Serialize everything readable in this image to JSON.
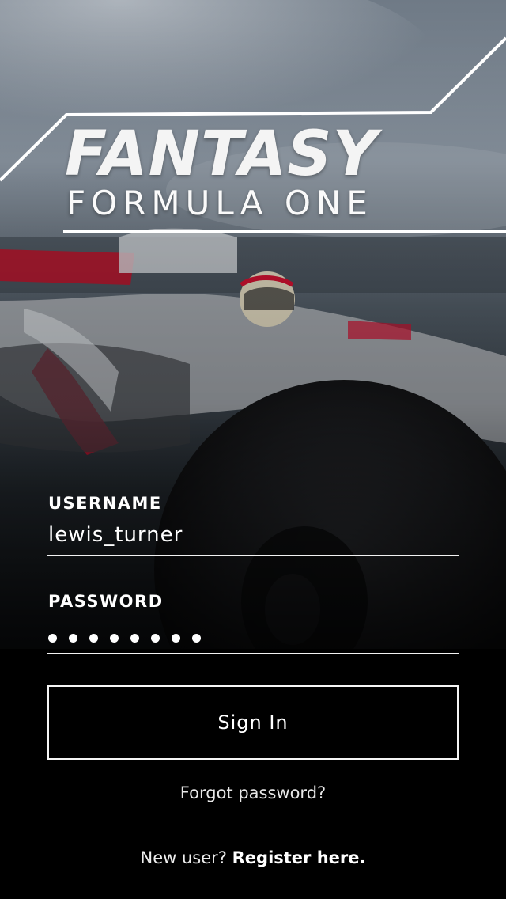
{
  "logo": {
    "title": "FANTASY",
    "subtitle": "FORMULA ONE"
  },
  "form": {
    "username_label": "USERNAME",
    "username_value": "lewis_turner",
    "password_label": "PASSWORD",
    "password_length": 8
  },
  "actions": {
    "signin_label": "Sign In",
    "forgot_label": "Forgot password?",
    "new_user_text": "New user?",
    "register_label": "Register here."
  },
  "icons": {
    "background": "race-car-photo",
    "password": "password-dot-icon"
  },
  "colors": {
    "text": "#ffffff",
    "background": "#000000",
    "car_red": "#c8102e",
    "car_silver": "#c9c9c9"
  }
}
